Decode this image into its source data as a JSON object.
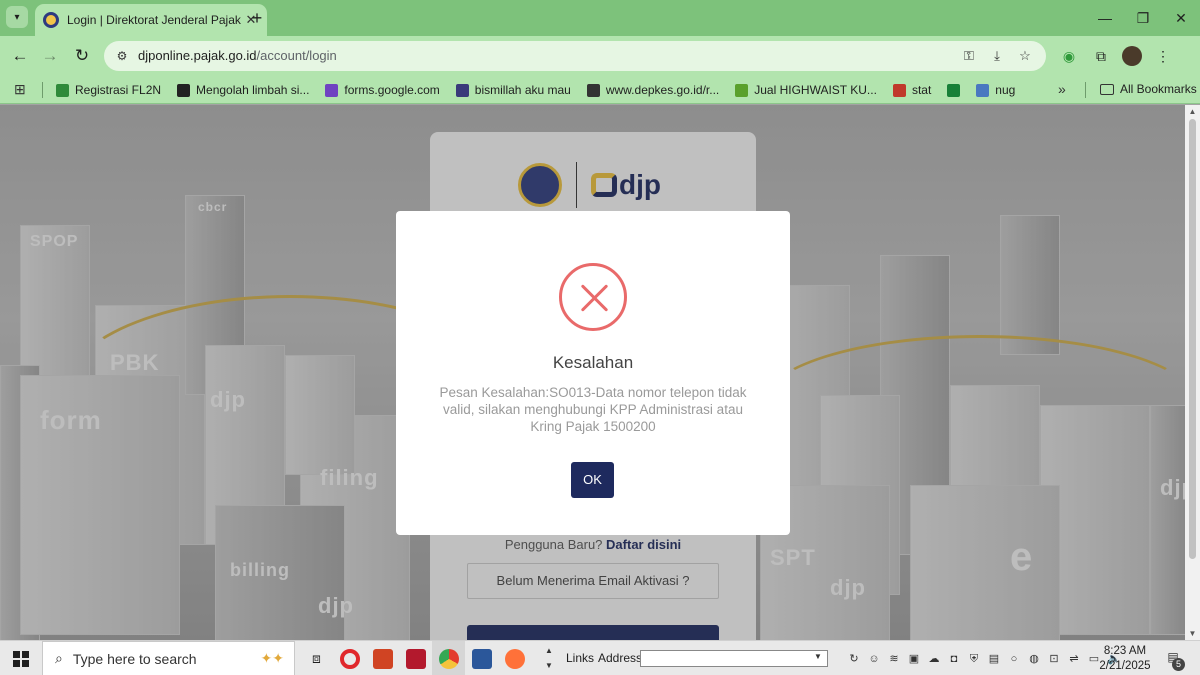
{
  "browser": {
    "tab_title": "Login | Direktorat Jenderal Pajak",
    "url_host": "djponline.pajak.go.id",
    "url_path": "/account/login",
    "bookmarks": [
      {
        "label": "Registrasi FL2N",
        "icon": "leaf-icon",
        "color": "#2f8a3a"
      },
      {
        "label": "Mengolah limbah si...",
        "icon": "k-icon",
        "color": "#222222"
      },
      {
        "label": "forms.google.com",
        "icon": "forms-icon",
        "color": "#6f42c1"
      },
      {
        "label": "bismillah aku mau",
        "icon": "bank-icon",
        "color": "#3a3a7a"
      },
      {
        "label": "www.depkes.go.id/r...",
        "icon": "globe-icon",
        "color": "#333333"
      },
      {
        "label": "Jual HIGHWAIST KU...",
        "icon": "shop-icon",
        "color": "#5aa02c"
      },
      {
        "label": "stat",
        "icon": "flag-icon",
        "color": "#c0392b"
      },
      {
        "label": "",
        "icon": "sheets-icon",
        "color": "#188038"
      },
      {
        "label": "nug",
        "icon": "gis-icon",
        "color": "#4a78c0"
      }
    ],
    "all_bookmarks": "All Bookmarks"
  },
  "page": {
    "new_user_prefix": "Pengguna Baru?",
    "new_user_link": "Daftar disini",
    "activation_button": "Belum Menerima Email Aktivasi ?",
    "logo_text": "djp",
    "background_labels": [
      "SPOP",
      "cbcr",
      "PBK",
      "djp",
      "form",
      "filing",
      "billing",
      "djp",
      "SPT",
      "djp",
      "djp",
      "e"
    ]
  },
  "modal": {
    "title": "Kesalahan",
    "message": "Pesan Kesalahan:SO013-Data nomor telepon tidak valid, silakan menghubungi KPP Administrasi atau Kring Pajak 1500200",
    "ok_label": "OK",
    "accent_color": "#e96a6a",
    "button_color": "#1e2a5e"
  },
  "taskbar": {
    "search_placeholder": "Type here to search",
    "links_label": "Links",
    "address_label": "Address",
    "time": "8:23 AM",
    "date": "2/21/2025",
    "notification_count": "5"
  }
}
